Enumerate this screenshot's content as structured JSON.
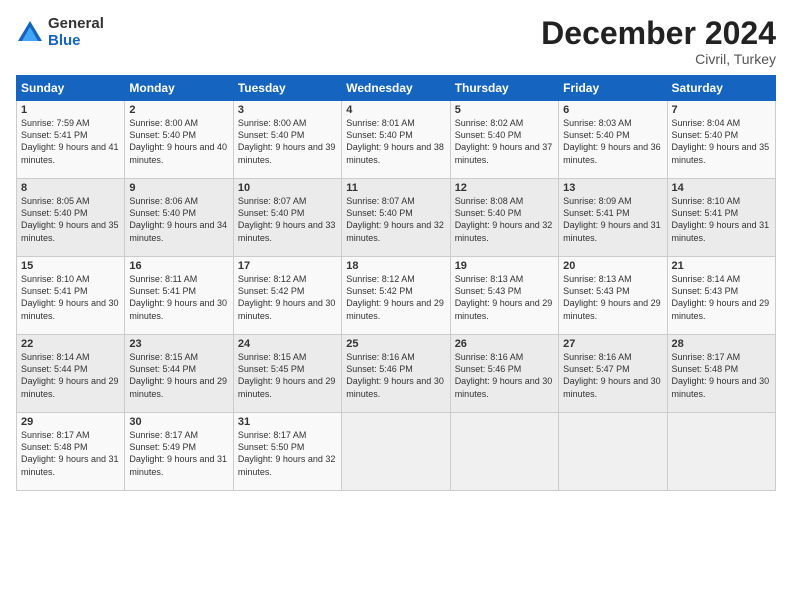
{
  "logo": {
    "general": "General",
    "blue": "Blue"
  },
  "title": "December 2024",
  "location": "Civril, Turkey",
  "days_header": [
    "Sunday",
    "Monday",
    "Tuesday",
    "Wednesday",
    "Thursday",
    "Friday",
    "Saturday"
  ],
  "weeks": [
    [
      {
        "day": "1",
        "sunrise": "Sunrise: 7:59 AM",
        "sunset": "Sunset: 5:41 PM",
        "daylight": "Daylight: 9 hours and 41 minutes."
      },
      {
        "day": "2",
        "sunrise": "Sunrise: 8:00 AM",
        "sunset": "Sunset: 5:40 PM",
        "daylight": "Daylight: 9 hours and 40 minutes."
      },
      {
        "day": "3",
        "sunrise": "Sunrise: 8:00 AM",
        "sunset": "Sunset: 5:40 PM",
        "daylight": "Daylight: 9 hours and 39 minutes."
      },
      {
        "day": "4",
        "sunrise": "Sunrise: 8:01 AM",
        "sunset": "Sunset: 5:40 PM",
        "daylight": "Daylight: 9 hours and 38 minutes."
      },
      {
        "day": "5",
        "sunrise": "Sunrise: 8:02 AM",
        "sunset": "Sunset: 5:40 PM",
        "daylight": "Daylight: 9 hours and 37 minutes."
      },
      {
        "day": "6",
        "sunrise": "Sunrise: 8:03 AM",
        "sunset": "Sunset: 5:40 PM",
        "daylight": "Daylight: 9 hours and 36 minutes."
      },
      {
        "day": "7",
        "sunrise": "Sunrise: 8:04 AM",
        "sunset": "Sunset: 5:40 PM",
        "daylight": "Daylight: 9 hours and 35 minutes."
      }
    ],
    [
      {
        "day": "8",
        "sunrise": "Sunrise: 8:05 AM",
        "sunset": "Sunset: 5:40 PM",
        "daylight": "Daylight: 9 hours and 35 minutes."
      },
      {
        "day": "9",
        "sunrise": "Sunrise: 8:06 AM",
        "sunset": "Sunset: 5:40 PM",
        "daylight": "Daylight: 9 hours and 34 minutes."
      },
      {
        "day": "10",
        "sunrise": "Sunrise: 8:07 AM",
        "sunset": "Sunset: 5:40 PM",
        "daylight": "Daylight: 9 hours and 33 minutes."
      },
      {
        "day": "11",
        "sunrise": "Sunrise: 8:07 AM",
        "sunset": "Sunset: 5:40 PM",
        "daylight": "Daylight: 9 hours and 32 minutes."
      },
      {
        "day": "12",
        "sunrise": "Sunrise: 8:08 AM",
        "sunset": "Sunset: 5:40 PM",
        "daylight": "Daylight: 9 hours and 32 minutes."
      },
      {
        "day": "13",
        "sunrise": "Sunrise: 8:09 AM",
        "sunset": "Sunset: 5:41 PM",
        "daylight": "Daylight: 9 hours and 31 minutes."
      },
      {
        "day": "14",
        "sunrise": "Sunrise: 8:10 AM",
        "sunset": "Sunset: 5:41 PM",
        "daylight": "Daylight: 9 hours and 31 minutes."
      }
    ],
    [
      {
        "day": "15",
        "sunrise": "Sunrise: 8:10 AM",
        "sunset": "Sunset: 5:41 PM",
        "daylight": "Daylight: 9 hours and 30 minutes."
      },
      {
        "day": "16",
        "sunrise": "Sunrise: 8:11 AM",
        "sunset": "Sunset: 5:41 PM",
        "daylight": "Daylight: 9 hours and 30 minutes."
      },
      {
        "day": "17",
        "sunrise": "Sunrise: 8:12 AM",
        "sunset": "Sunset: 5:42 PM",
        "daylight": "Daylight: 9 hours and 30 minutes."
      },
      {
        "day": "18",
        "sunrise": "Sunrise: 8:12 AM",
        "sunset": "Sunset: 5:42 PM",
        "daylight": "Daylight: 9 hours and 29 minutes."
      },
      {
        "day": "19",
        "sunrise": "Sunrise: 8:13 AM",
        "sunset": "Sunset: 5:43 PM",
        "daylight": "Daylight: 9 hours and 29 minutes."
      },
      {
        "day": "20",
        "sunrise": "Sunrise: 8:13 AM",
        "sunset": "Sunset: 5:43 PM",
        "daylight": "Daylight: 9 hours and 29 minutes."
      },
      {
        "day": "21",
        "sunrise": "Sunrise: 8:14 AM",
        "sunset": "Sunset: 5:43 PM",
        "daylight": "Daylight: 9 hours and 29 minutes."
      }
    ],
    [
      {
        "day": "22",
        "sunrise": "Sunrise: 8:14 AM",
        "sunset": "Sunset: 5:44 PM",
        "daylight": "Daylight: 9 hours and 29 minutes."
      },
      {
        "day": "23",
        "sunrise": "Sunrise: 8:15 AM",
        "sunset": "Sunset: 5:44 PM",
        "daylight": "Daylight: 9 hours and 29 minutes."
      },
      {
        "day": "24",
        "sunrise": "Sunrise: 8:15 AM",
        "sunset": "Sunset: 5:45 PM",
        "daylight": "Daylight: 9 hours and 29 minutes."
      },
      {
        "day": "25",
        "sunrise": "Sunrise: 8:16 AM",
        "sunset": "Sunset: 5:46 PM",
        "daylight": "Daylight: 9 hours and 30 minutes."
      },
      {
        "day": "26",
        "sunrise": "Sunrise: 8:16 AM",
        "sunset": "Sunset: 5:46 PM",
        "daylight": "Daylight: 9 hours and 30 minutes."
      },
      {
        "day": "27",
        "sunrise": "Sunrise: 8:16 AM",
        "sunset": "Sunset: 5:47 PM",
        "daylight": "Daylight: 9 hours and 30 minutes."
      },
      {
        "day": "28",
        "sunrise": "Sunrise: 8:17 AM",
        "sunset": "Sunset: 5:48 PM",
        "daylight": "Daylight: 9 hours and 30 minutes."
      }
    ],
    [
      {
        "day": "29",
        "sunrise": "Sunrise: 8:17 AM",
        "sunset": "Sunset: 5:48 PM",
        "daylight": "Daylight: 9 hours and 31 minutes."
      },
      {
        "day": "30",
        "sunrise": "Sunrise: 8:17 AM",
        "sunset": "Sunset: 5:49 PM",
        "daylight": "Daylight: 9 hours and 31 minutes."
      },
      {
        "day": "31",
        "sunrise": "Sunrise: 8:17 AM",
        "sunset": "Sunset: 5:50 PM",
        "daylight": "Daylight: 9 hours and 32 minutes."
      },
      null,
      null,
      null,
      null
    ]
  ]
}
